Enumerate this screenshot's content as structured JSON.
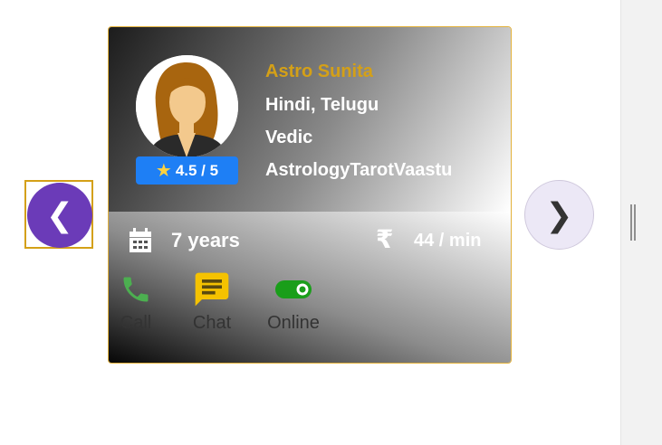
{
  "astrologer": {
    "name": "Astro Sunita",
    "languages": "Hindi, Telugu",
    "style": "Vedic",
    "skills": "AstrologyTarotVaastu",
    "rating": "4.5 / 5",
    "experience": "7 years",
    "price": "44 / min"
  },
  "actions": {
    "call": "Call",
    "chat": "Chat",
    "online": "Online"
  },
  "nav": {
    "prev": "❮",
    "next": "❯"
  },
  "icons": {
    "rating": "star-icon",
    "experience": "calendar-icon",
    "price": "rupee-icon",
    "call": "phone-icon",
    "chat": "chat-bubble-icon",
    "online": "toggle-on-icon"
  },
  "colors": {
    "name": "#d4a017",
    "rating_badge": "#1e7ff5",
    "nav_prev": "#6b3bb8",
    "call": "#4caf50",
    "chat": "#f5c200",
    "online": "#1a9e1a",
    "card_border": "#e3b23c"
  }
}
